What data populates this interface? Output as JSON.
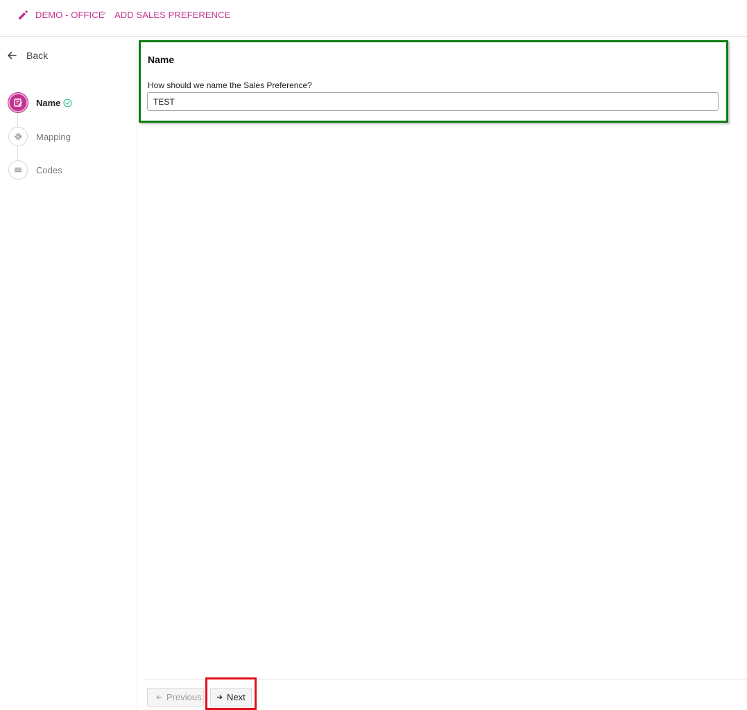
{
  "breadcrumb": {
    "icon": "pencil-icon",
    "office": "DEMO - OFFICE",
    "separator": ">",
    "page": "ADD SALES PREFERENCE"
  },
  "sidebar": {
    "back_label": "Back",
    "steps": [
      {
        "label": "Name",
        "icon": "edit-icon",
        "active": true,
        "completed": true
      },
      {
        "label": "Mapping",
        "icon": "gear-icon",
        "active": false,
        "completed": false
      },
      {
        "label": "Codes",
        "icon": "list-icon",
        "active": false,
        "completed": false
      }
    ]
  },
  "form": {
    "title": "Name",
    "question": "How should we name the Sales Preference?",
    "value": "TEST"
  },
  "footer": {
    "previous_label": "Previous",
    "next_label": "Next"
  },
  "colors": {
    "accent": "#c2338f",
    "success": "#3cc38f",
    "highlight_green": "#0f7d12",
    "highlight_red": "#e0101a"
  }
}
